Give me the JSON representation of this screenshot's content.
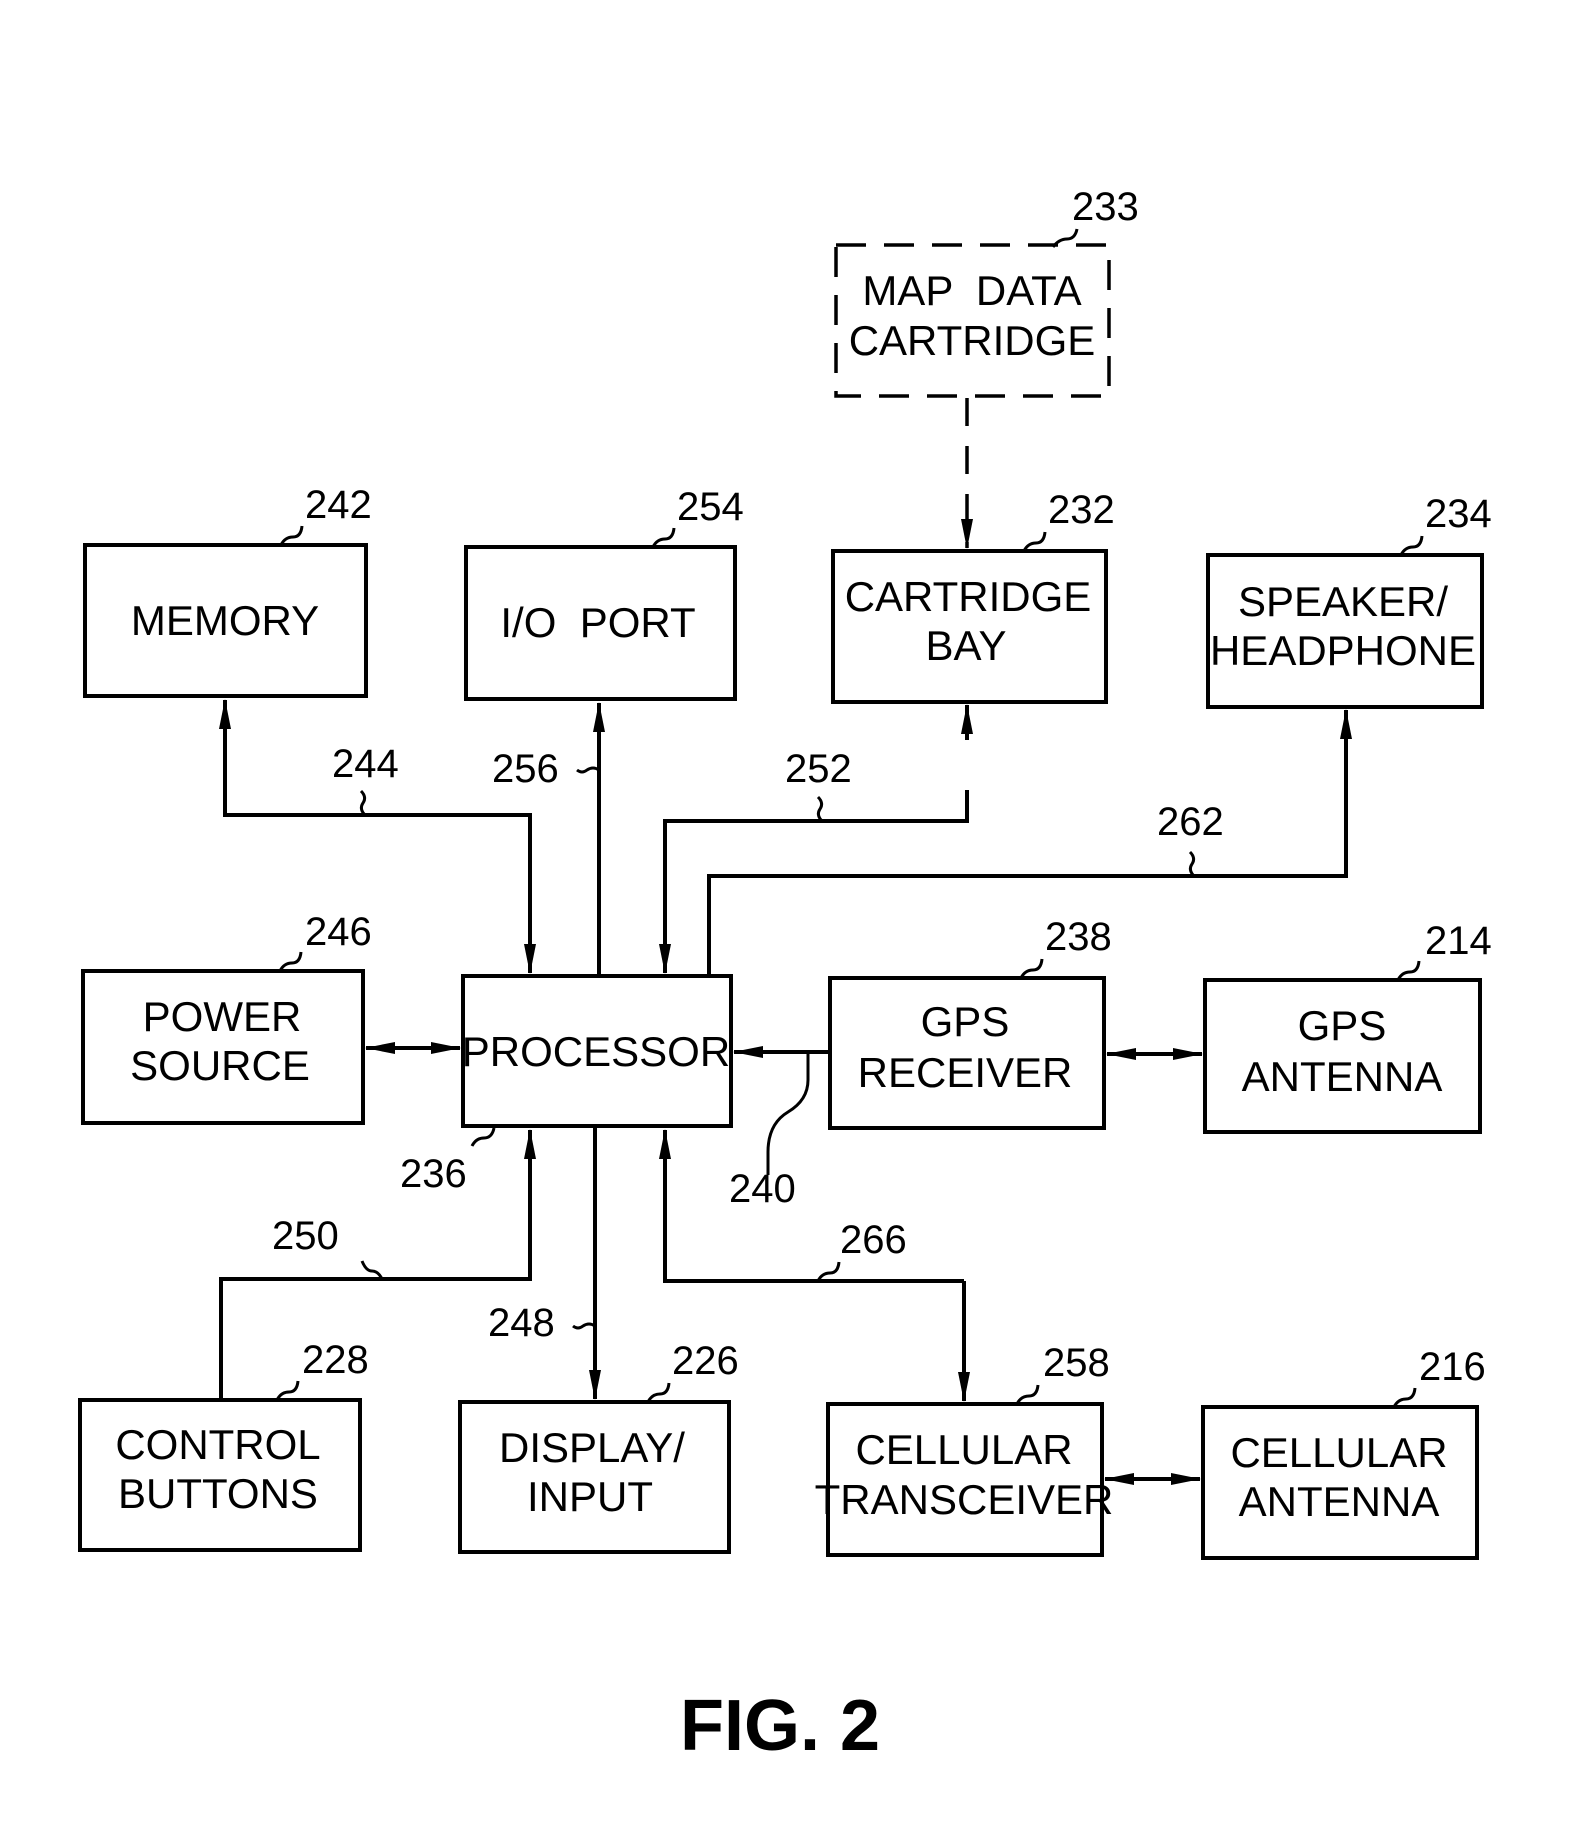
{
  "figure": {
    "caption": "FIG. 2",
    "colors": {
      "ink": "#000000",
      "background": "#ffffff"
    }
  },
  "blocks": [
    {
      "id": "map_data_cartridge",
      "ref": "233",
      "lines": [
        "MAP  DATA",
        "CARTRIDGE"
      ],
      "style": "dashed"
    },
    {
      "id": "memory",
      "ref": "242",
      "lines": [
        "MEMORY"
      ],
      "style": "solid"
    },
    {
      "id": "io_port",
      "ref": "254",
      "lines": [
        "I/O  PORT"
      ],
      "style": "solid"
    },
    {
      "id": "cartridge_bay",
      "ref": "232",
      "lines": [
        "CARTRIDGE",
        "BAY"
      ],
      "style": "solid"
    },
    {
      "id": "speaker_headphone",
      "ref": "234",
      "lines": [
        "SPEAKER/",
        "HEADPHONE"
      ],
      "style": "solid"
    },
    {
      "id": "power_source",
      "ref": "246",
      "lines": [
        "POWER",
        "SOURCE"
      ],
      "style": "solid"
    },
    {
      "id": "processor",
      "ref": "236",
      "lines": [
        "PROCESSOR"
      ],
      "style": "solid"
    },
    {
      "id": "gps_receiver",
      "ref": "238",
      "lines": [
        "GPS",
        "RECEIVER"
      ],
      "style": "solid"
    },
    {
      "id": "gps_antenna",
      "ref": "214",
      "lines": [
        "GPS",
        "ANTENNA"
      ],
      "style": "solid"
    },
    {
      "id": "control_buttons",
      "ref": "228",
      "lines": [
        "CONTROL",
        "BUTTONS"
      ],
      "style": "solid"
    },
    {
      "id": "display_input",
      "ref": "226",
      "lines": [
        "DISPLAY/",
        "INPUT"
      ],
      "style": "solid"
    },
    {
      "id": "cellular_transceiver",
      "ref": "258",
      "lines": [
        "CELLULAR",
        "TRANSCEIVER"
      ],
      "style": "solid"
    },
    {
      "id": "cellular_antenna",
      "ref": "216",
      "lines": [
        "CELLULAR",
        "ANTENNA"
      ],
      "style": "solid"
    }
  ],
  "connections": [
    {
      "ref": "244",
      "from": "processor",
      "to": "memory",
      "direction": "bidirectional-elbow"
    },
    {
      "ref": "256",
      "from": "processor",
      "to": "io_port",
      "direction": "to"
    },
    {
      "ref": "252",
      "from": "cartridge_bay",
      "to": "processor",
      "direction": "bidirectional-elbow"
    },
    {
      "ref": "262",
      "from": "processor",
      "to": "speaker_headphone",
      "direction": "to"
    },
    {
      "ref": "",
      "from": "power_source",
      "to": "processor",
      "direction": "bidirectional"
    },
    {
      "ref": "240",
      "from": "gps_receiver",
      "to": "processor",
      "direction": "to"
    },
    {
      "ref": "",
      "from": "gps_receiver",
      "to": "gps_antenna",
      "direction": "bidirectional"
    },
    {
      "ref": "250",
      "from": "control_buttons",
      "to": "processor",
      "direction": "to"
    },
    {
      "ref": "248",
      "from": "processor",
      "to": "display_input",
      "direction": "to"
    },
    {
      "ref": "266",
      "from": "cellular_transceiver",
      "to": "processor",
      "direction": "bidirectional-elbow"
    },
    {
      "ref": "",
      "from": "cellular_transceiver",
      "to": "cellular_antenna",
      "direction": "bidirectional"
    },
    {
      "ref": "",
      "from": "map_data_cartridge",
      "to": "cartridge_bay",
      "direction": "to",
      "style": "dashed"
    }
  ],
  "labels": {
    "map_data_cartridge": "233",
    "memory": "242",
    "io_port": "254",
    "cartridge_bay": "232",
    "speaker_headphone": "234",
    "power_source": "246",
    "processor": "236",
    "gps_receiver": "238",
    "gps_antenna": "214",
    "control_buttons": "228",
    "display_input": "226",
    "cellular_transceiver": "258",
    "cellular_antenna": "216",
    "bus_memory": "244",
    "bus_io": "256",
    "bus_cartridge": "252",
    "bus_speaker": "262",
    "bus_gps": "240",
    "bus_control": "250",
    "bus_display": "248",
    "bus_cellular": "266"
  }
}
